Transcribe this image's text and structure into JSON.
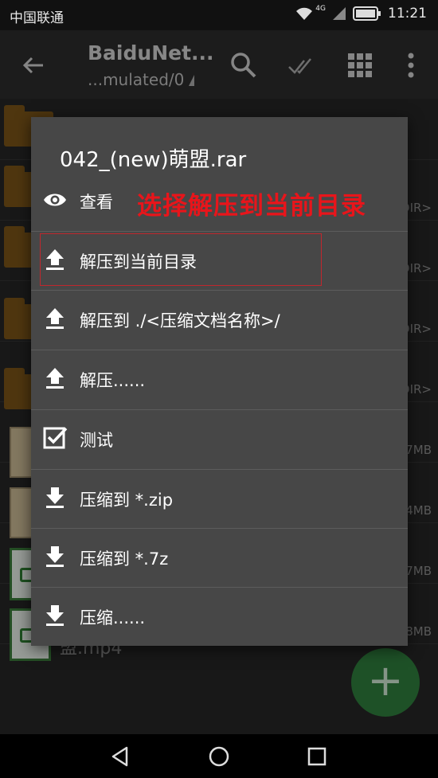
{
  "status_bar": {
    "carrier": "中国联通",
    "network": "4G",
    "time": "11:21"
  },
  "app_bar": {
    "title": "BaiduNet...",
    "subtitle": "...mulated/0"
  },
  "background_rows": [
    {
      "right_label": ""
    },
    {
      "right_label": "DIR>"
    },
    {
      "right_label": "DIR>"
    },
    {
      "right_label": "DIR>"
    },
    {
      "right_label": "DIR>"
    },
    {
      "right_label": "7MB"
    },
    {
      "right_label": "4MB"
    },
    {
      "right_label": "7MB"
    },
    {
      "right_label": "8MB"
    }
  ],
  "background_last_name": "盟.mp4",
  "fab_label": "+",
  "dialog": {
    "title": "042_(new)萌盟.rar",
    "annotation": "选择解压到当前目录",
    "items": [
      {
        "label": "查看",
        "icon": "eye-icon"
      },
      {
        "label": "解压到当前目录",
        "icon": "upload-icon"
      },
      {
        "label": "解压到 ./<压缩文档名称>/",
        "icon": "upload-icon"
      },
      {
        "label": "解压......",
        "icon": "upload-icon"
      },
      {
        "label": "测试",
        "icon": "checkbox-icon"
      },
      {
        "label": "压缩到 *.zip",
        "icon": "download-icon"
      },
      {
        "label": "压缩到 *.7z",
        "icon": "download-icon"
      },
      {
        "label": "压缩......",
        "icon": "download-icon"
      }
    ]
  },
  "colors": {
    "annotation": "#e8151b",
    "fab": "#2e7d3c",
    "dialog_bg": "#474747"
  }
}
